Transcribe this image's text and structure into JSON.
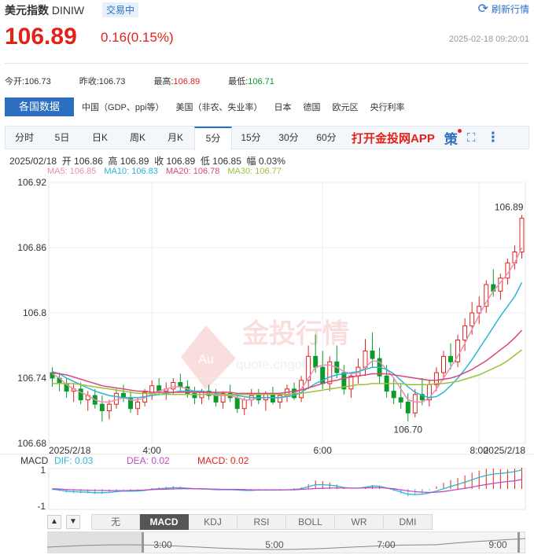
{
  "header": {
    "name": "美元指数",
    "code": "DINIW",
    "status": "交易中",
    "refresh_label": "刷新行情",
    "price": "106.89",
    "change": "0.16(0.15%)",
    "timestamp": "2025-02-18 09:20:01"
  },
  "stats": [
    {
      "label": "今开:",
      "value": "106.73",
      "tone": "neutral"
    },
    {
      "label": "昨收:",
      "value": "106.73",
      "tone": "neutral"
    },
    {
      "label": "最高:",
      "value": "106.89",
      "tone": "up"
    },
    {
      "label": "最低:",
      "value": "106.71",
      "tone": "down"
    }
  ],
  "categories": {
    "active": "各国数据",
    "items": [
      "中国（GDP、ppi等）",
      "美国（非农、失业率）",
      "日本",
      "德国",
      "欧元区",
      "央行利率"
    ]
  },
  "tabs": [
    "分时",
    "5日",
    "日K",
    "周K",
    "月K",
    "5分",
    "15分",
    "30分",
    "60分"
  ],
  "active_tab": "5分",
  "app_link": "打开金投网APP",
  "strategy_label": "策",
  "ohlc_line": "2025/02/18  开 106.86  高 106.89  收 106.89  低 106.85  幅 0.03%",
  "ma": [
    {
      "label": "MA5: 106.85",
      "color": "#e98fb8"
    },
    {
      "label": "MA10: 106.83",
      "color": "#29b6d8"
    },
    {
      "label": "MA20: 106.78",
      "color": "#d9467e"
    },
    {
      "label": "MA30: 106.77",
      "color": "#9cc23a"
    }
  ],
  "colors": {
    "up": "#e32119",
    "down": "#0a9b2a",
    "accent": "#2d6fbf"
  },
  "chart_data": {
    "type": "candlestick",
    "y_ticks": [
      "106.92",
      "106.86",
      "106.8",
      "106.74",
      "106.68"
    ],
    "ylim": [
      106.68,
      106.92
    ],
    "x_labels": [
      "2025/2/18",
      "4:00",
      "6:00",
      "8:00",
      "2025/2/18"
    ],
    "annotations": {
      "high": "106.89",
      "low": "106.70"
    },
    "watermark": {
      "brand": "金投行情",
      "url": "quote.cngold.org",
      "logo": "Au"
    },
    "candles": [
      [
        106.745,
        106.75,
        106.732,
        106.74
      ],
      [
        106.74,
        106.745,
        106.728,
        106.735
      ],
      [
        106.735,
        106.74,
        106.722,
        106.728
      ],
      [
        106.728,
        106.735,
        106.718,
        106.73
      ],
      [
        106.73,
        106.736,
        106.716,
        106.72
      ],
      [
        106.72,
        106.728,
        106.71,
        106.724
      ],
      [
        106.724,
        106.73,
        106.712,
        106.716
      ],
      [
        106.716,
        106.724,
        106.7,
        106.71
      ],
      [
        106.71,
        106.72,
        106.702,
        106.716
      ],
      [
        106.716,
        106.73,
        106.712,
        106.726
      ],
      [
        106.726,
        106.734,
        106.718,
        106.722
      ],
      [
        106.722,
        106.728,
        106.708,
        106.712
      ],
      [
        106.712,
        106.722,
        106.706,
        106.718
      ],
      [
        106.718,
        106.73,
        106.714,
        106.727
      ],
      [
        106.727,
        106.738,
        106.72,
        106.733
      ],
      [
        106.733,
        106.74,
        106.724,
        106.728
      ],
      [
        106.728,
        106.736,
        106.72,
        106.73
      ],
      [
        106.73,
        106.74,
        106.725,
        106.736
      ],
      [
        106.736,
        106.744,
        106.728,
        106.732
      ],
      [
        106.732,
        106.738,
        106.722,
        106.726
      ],
      [
        106.726,
        106.732,
        106.716,
        106.722
      ],
      [
        106.722,
        106.73,
        106.716,
        106.728
      ],
      [
        106.728,
        106.734,
        106.72,
        106.724
      ],
      [
        106.724,
        106.73,
        106.714,
        106.718
      ],
      [
        106.718,
        106.728,
        106.712,
        106.726
      ],
      [
        106.726,
        106.734,
        106.718,
        106.722
      ],
      [
        106.722,
        106.726,
        106.708,
        106.712
      ],
      [
        106.712,
        106.722,
        106.706,
        106.72
      ],
      [
        106.72,
        106.73,
        106.714,
        106.724
      ],
      [
        106.724,
        106.73,
        106.716,
        106.72
      ],
      [
        106.72,
        106.728,
        106.71,
        106.726
      ],
      [
        106.726,
        106.732,
        106.716,
        106.718
      ],
      [
        106.718,
        106.726,
        106.712,
        106.724
      ],
      [
        106.724,
        106.734,
        106.718,
        106.73
      ],
      [
        106.73,
        106.736,
        106.72,
        106.722
      ],
      [
        106.722,
        106.742,
        106.718,
        106.738
      ],
      [
        106.738,
        106.77,
        106.73,
        106.76
      ],
      [
        106.76,
        106.78,
        106.745,
        106.75
      ],
      [
        106.75,
        106.765,
        106.73,
        106.735
      ],
      [
        106.735,
        106.76,
        106.728,
        106.755
      ],
      [
        106.755,
        106.77,
        106.74,
        106.745
      ],
      [
        106.745,
        106.752,
        106.725,
        106.73
      ],
      [
        106.73,
        106.745,
        106.722,
        106.742
      ],
      [
        106.742,
        106.758,
        106.735,
        106.75
      ],
      [
        106.75,
        106.776,
        106.742,
        106.765
      ],
      [
        106.765,
        106.782,
        106.75,
        106.758
      ],
      [
        106.758,
        106.768,
        106.735,
        106.742
      ],
      [
        106.742,
        106.752,
        106.722,
        106.728
      ],
      [
        106.728,
        106.74,
        106.716,
        106.722
      ],
      [
        106.722,
        106.735,
        106.712,
        106.718
      ],
      [
        106.718,
        106.726,
        106.7,
        106.708
      ],
      [
        106.708,
        106.73,
        106.704,
        106.725
      ],
      [
        106.725,
        106.74,
        106.715,
        106.72
      ],
      [
        106.72,
        106.738,
        106.714,
        106.734
      ],
      [
        106.734,
        106.75,
        106.728,
        106.745
      ],
      [
        106.745,
        106.765,
        106.738,
        106.76
      ],
      [
        106.76,
        106.772,
        106.748,
        106.755
      ],
      [
        106.755,
        106.78,
        106.75,
        106.775
      ],
      [
        106.775,
        106.795,
        106.765,
        106.788
      ],
      [
        106.788,
        106.81,
        106.78,
        106.8
      ],
      [
        106.8,
        106.815,
        106.79,
        106.806
      ],
      [
        106.806,
        106.83,
        106.8,
        106.826
      ],
      [
        106.826,
        106.84,
        106.815,
        106.82
      ],
      [
        106.82,
        106.836,
        106.812,
        106.832
      ],
      [
        106.832,
        106.85,
        106.826,
        106.846
      ],
      [
        106.846,
        106.862,
        106.84,
        106.856
      ],
      [
        106.856,
        106.89,
        106.85,
        106.887
      ]
    ],
    "ma_series": {
      "MA5": [
        106.744,
        106.74,
        106.734,
        106.73,
        106.727,
        106.724,
        106.72,
        106.718,
        106.718,
        106.72,
        106.722,
        106.72,
        106.72,
        106.722,
        106.726,
        106.728,
        106.73,
        106.732,
        106.732,
        106.73,
        106.728,
        106.727,
        106.726,
        106.724,
        106.724,
        106.724,
        106.722,
        106.72,
        106.72,
        106.722,
        106.722,
        106.722,
        106.722,
        106.724,
        106.726,
        106.73,
        106.74,
        106.75,
        106.752,
        106.752,
        106.75,
        106.746,
        106.744,
        106.745,
        106.75,
        106.756,
        106.755,
        106.748,
        106.74,
        106.73,
        106.72,
        106.718,
        106.718,
        106.722,
        106.73,
        106.74,
        106.75,
        106.76,
        106.772,
        106.785,
        106.798,
        106.81,
        106.82,
        106.828,
        106.836,
        106.846,
        106.86
      ],
      "MA10": [
        106.746,
        106.744,
        106.74,
        106.737,
        106.734,
        106.731,
        106.728,
        106.726,
        106.724,
        106.723,
        106.722,
        106.722,
        106.722,
        106.723,
        106.724,
        106.725,
        106.726,
        106.727,
        106.728,
        106.728,
        106.728,
        106.728,
        106.727,
        106.726,
        106.725,
        106.725,
        106.724,
        106.723,
        106.722,
        106.722,
        106.722,
        106.722,
        106.722,
        106.723,
        106.724,
        106.727,
        106.731,
        106.735,
        106.738,
        106.741,
        106.743,
        106.744,
        106.745,
        106.746,
        106.748,
        106.75,
        106.75,
        106.748,
        106.744,
        106.738,
        106.732,
        106.727,
        106.724,
        106.722,
        106.723,
        106.727,
        106.733,
        106.74,
        106.748,
        106.757,
        106.767,
        106.777,
        106.787,
        106.797,
        106.806,
        106.815,
        106.828
      ],
      "MA20": [
        106.745,
        106.744,
        106.743,
        106.741,
        106.739,
        106.737,
        106.735,
        106.733,
        106.732,
        106.731,
        106.73,
        106.729,
        106.728,
        106.728,
        106.727,
        106.727,
        106.727,
        106.727,
        106.727,
        106.727,
        106.727,
        106.727,
        106.727,
        106.727,
        106.727,
        106.727,
        106.726,
        106.726,
        106.726,
        106.726,
        106.726,
        106.726,
        106.726,
        106.727,
        106.728,
        106.729,
        106.731,
        106.733,
        106.735,
        106.737,
        106.738,
        106.74,
        106.741,
        106.742,
        106.743,
        106.744,
        106.744,
        106.744,
        106.743,
        106.742,
        106.741,
        106.74,
        106.739,
        106.738,
        106.738,
        106.739,
        106.74,
        106.742,
        106.745,
        106.748,
        106.752,
        106.756,
        106.761,
        106.766,
        106.771,
        106.777,
        106.784
      ],
      "MA30": [
        106.735,
        106.735,
        106.735,
        106.735,
        106.734,
        106.733,
        106.732,
        106.731,
        106.73,
        106.729,
        106.728,
        106.727,
        106.726,
        106.726,
        106.726,
        106.725,
        106.725,
        106.725,
        106.725,
        106.725,
        106.725,
        106.725,
        106.725,
        106.725,
        106.725,
        106.725,
        106.725,
        106.725,
        106.725,
        106.725,
        106.725,
        106.725,
        106.725,
        106.725,
        106.726,
        106.726,
        106.727,
        106.728,
        106.729,
        106.73,
        106.731,
        106.732,
        106.733,
        106.734,
        106.734,
        106.735,
        106.735,
        106.735,
        106.735,
        106.735,
        106.734,
        106.734,
        106.734,
        106.734,
        106.735,
        106.735,
        106.736,
        106.737,
        106.739,
        106.741,
        106.743,
        106.746,
        106.749,
        106.752,
        106.756,
        106.761,
        106.766
      ]
    }
  },
  "macd": {
    "label": "MACD",
    "dif": "DIF: 0.03",
    "dea": "DEA: 0.02",
    "macd": "MACD: 0.02",
    "y_ticks": [
      "1",
      "-1"
    ]
  },
  "indicators": [
    "无",
    "MACD",
    "KDJ",
    "RSI",
    "BOLL",
    "WR",
    "DMI"
  ],
  "active_indicator": "MACD",
  "navigator_labels": [
    "3:00",
    "5:00",
    "7:00",
    "9:00"
  ]
}
